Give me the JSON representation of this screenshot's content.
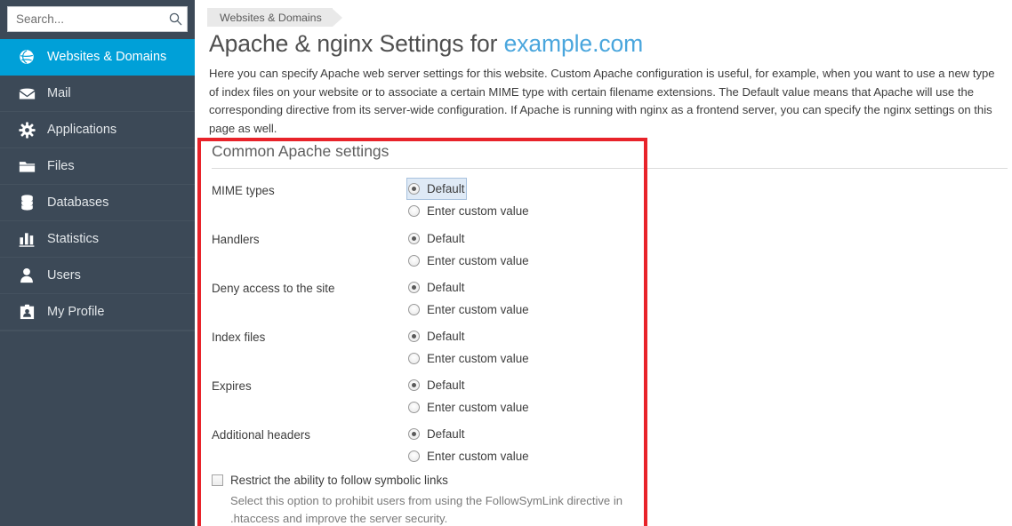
{
  "sidebar": {
    "search": {
      "placeholder": "Search...",
      "value": "",
      "icon": "search-icon"
    },
    "items": [
      {
        "label": "Websites & Domains",
        "icon": "globe-icon",
        "active": true
      },
      {
        "label": "Mail",
        "icon": "envelope-icon",
        "active": false
      },
      {
        "label": "Applications",
        "icon": "gear-icon",
        "active": false
      },
      {
        "label": "Files",
        "icon": "folder-icon",
        "active": false
      },
      {
        "label": "Databases",
        "icon": "database-icon",
        "active": false
      },
      {
        "label": "Statistics",
        "icon": "bar-chart-icon",
        "active": false
      },
      {
        "label": "Users",
        "icon": "user-icon",
        "active": false
      },
      {
        "label": "My Profile",
        "icon": "id-card-icon",
        "active": false
      }
    ]
  },
  "content": {
    "breadcrumb": [
      "Websites & Domains"
    ],
    "title_prefix": "Apache & nginx Settings for ",
    "title_domain": "example.com",
    "description": "Here you can specify Apache web server settings for this website. Custom Apache configuration is useful, for example, when you want to use a new type of index files on your website or to associate a certain MIME type with certain filename extensions. The Default value means that Apache will use the corresponding directive from its server-wide configuration. If Apache is running with nginx as a frontend server, you can specify the nginx settings on this page as well.",
    "panel": {
      "title": "Common Apache settings",
      "option_default": "Default",
      "option_custom": "Enter custom value",
      "rows": [
        {
          "label": "MIME types",
          "selected": "default",
          "focused": true
        },
        {
          "label": "Handlers",
          "selected": "default",
          "focused": false
        },
        {
          "label": "Deny access to the site",
          "selected": "default",
          "focused": false
        },
        {
          "label": "Index files",
          "selected": "default",
          "focused": false
        },
        {
          "label": "Expires",
          "selected": "default",
          "focused": false
        },
        {
          "label": "Additional headers",
          "selected": "default",
          "focused": false
        }
      ],
      "checkbox": {
        "label": "Restrict the ability to follow symbolic links",
        "checked": false,
        "hint": "Select this option to prohibit users from using the FollowSymLink directive in .htaccess and improve the server security."
      }
    }
  },
  "colors": {
    "sidebar_bg": "#3c4957",
    "sidebar_active": "#00a0d8",
    "link_blue": "#4aa6dd",
    "annotation_red": "#e8232a",
    "focus_ring": "#dfeaf6"
  }
}
